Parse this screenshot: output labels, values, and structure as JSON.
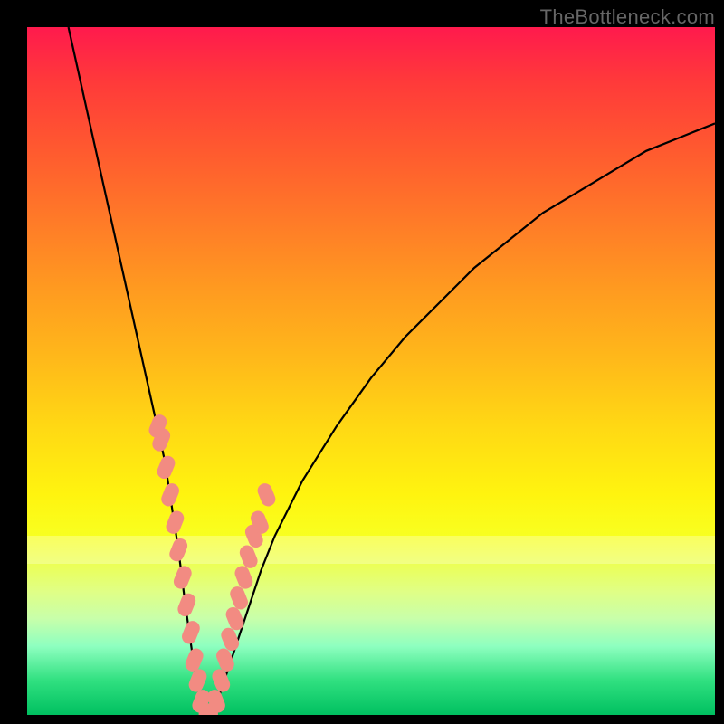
{
  "watermark": "TheBottleneck.com",
  "colors": {
    "frame": "#000000",
    "curve": "#000000",
    "marker_fill": "#f28b82",
    "marker_stroke": "#e06666",
    "gradient_top": "#ff1a4d",
    "gradient_bottom": "#00c060"
  },
  "chart_data": {
    "type": "line",
    "title": "",
    "xlabel": "",
    "ylabel": "",
    "xlim": [
      0,
      100
    ],
    "ylim": [
      0,
      100
    ],
    "grid": false,
    "legend": false,
    "series": [
      {
        "name": "bottleneck-curve",
        "x": [
          6,
          8,
          10,
          12,
          14,
          16,
          18,
          20,
          22,
          23,
          24,
          25,
          26,
          27,
          28,
          30,
          32,
          34,
          36,
          40,
          45,
          50,
          55,
          60,
          65,
          70,
          75,
          80,
          85,
          90,
          95,
          100
        ],
        "y": [
          100,
          91,
          82,
          73,
          64,
          55,
          46,
          37,
          24,
          16,
          9,
          3,
          0,
          0,
          3,
          9,
          15,
          21,
          26,
          34,
          42,
          49,
          55,
          60,
          65,
          69,
          73,
          76,
          79,
          82,
          84,
          86
        ]
      }
    ],
    "markers": {
      "name": "highlighted-points",
      "x": [
        19.0,
        19.5,
        20.2,
        20.8,
        21.5,
        22.0,
        22.6,
        23.2,
        23.8,
        24.3,
        24.8,
        25.3,
        26.0,
        26.7,
        27.5,
        28.2,
        28.8,
        29.5,
        30.2,
        30.8,
        31.5,
        32.2,
        33.0,
        33.8,
        34.8
      ],
      "y": [
        42,
        40,
        36,
        32,
        28,
        24,
        20,
        16,
        12,
        8,
        5,
        2,
        0,
        0,
        2,
        5,
        8,
        11,
        14,
        17,
        20,
        23,
        26,
        28,
        32
      ]
    },
    "white_band": {
      "y_start": 22,
      "y_end": 26
    }
  }
}
